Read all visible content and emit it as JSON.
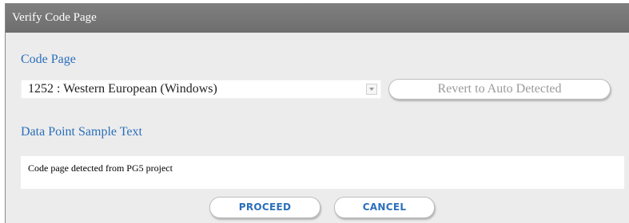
{
  "dialog": {
    "title": "Verify Code Page"
  },
  "code_page": {
    "label": "Code Page",
    "selected_value": "1252 : Western European (Windows)",
    "revert_button_label": "Revert to Auto Detected"
  },
  "sample_text": {
    "label": "Data Point Sample Text",
    "value": "Code page detected from PG5 project"
  },
  "actions": {
    "proceed_label": "PROCEED",
    "cancel_label": "CANCEL"
  },
  "colors": {
    "title_bar": "#777777",
    "dialog_background": "#ececec",
    "accent_text": "#2a6fbb",
    "disabled_text": "#9a9a9a"
  }
}
